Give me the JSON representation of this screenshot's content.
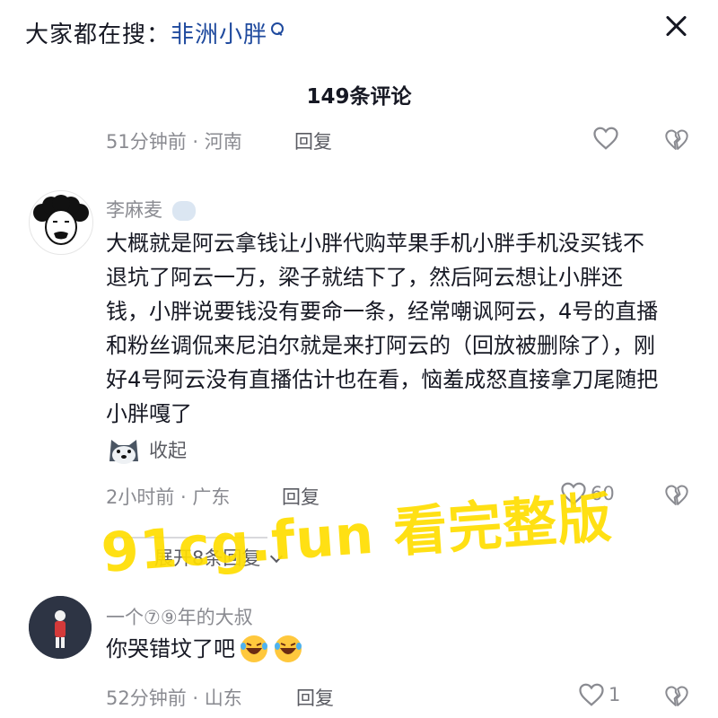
{
  "header": {
    "search_prefix": "大家都在搜：",
    "search_term": "非洲小胖"
  },
  "panel": {
    "comment_count": "149条评论"
  },
  "comments": [
    {
      "meta": "51分钟前 · 河南",
      "reply": "回复"
    },
    {
      "username": "李麻麦",
      "content": "大概就是阿云拿钱让小胖代购苹果手机小胖手机没买钱不退坑了阿云一万，梁子就结下了，然后阿云想让小胖还钱，小胖说要钱没有要命一条，经常嘲讽阿云，4号的直播和粉丝调侃来尼泊尔就是来打阿云的（回放被删除了），刚好4号阿云没有直播估计也在看，恼羞成怒直接拿刀尾随把小胖嘎了",
      "collapse": "收起",
      "meta": "2小时前 · 广东",
      "reply": "回复",
      "likes": "60",
      "expand_replies": "展开8条回复"
    },
    {
      "username": "一个⑦⑨年的大叔",
      "content": "你哭错坟了吧",
      "meta": "52分钟前 · 山东",
      "reply": "回复",
      "likes": "1"
    }
  ],
  "watermark": "91cg.fun 看完整版",
  "colors": {
    "text": "#161823",
    "meta": "#8a8b91",
    "link": "#1f4a9e",
    "watermark": "#ffdd00"
  }
}
